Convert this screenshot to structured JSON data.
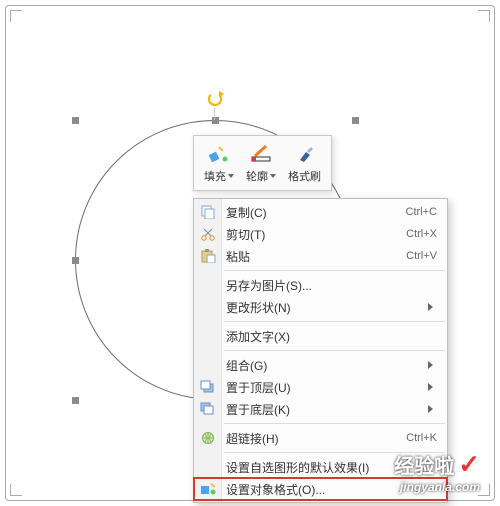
{
  "toolbar": {
    "fill": "填充",
    "outline": "轮廓",
    "format_brush": "格式刷"
  },
  "menu": {
    "copy": {
      "label": "复制(C)",
      "shortcut": "Ctrl+C"
    },
    "cut": {
      "label": "剪切(T)",
      "shortcut": "Ctrl+X"
    },
    "paste": {
      "label": "粘贴",
      "shortcut": "Ctrl+V"
    },
    "save_as_pic": {
      "label": "另存为图片(S)..."
    },
    "change_shape": {
      "label": "更改形状(N)"
    },
    "add_text": {
      "label": "添加文字(X)"
    },
    "group": {
      "label": "组合(G)"
    },
    "bring_front": {
      "label": "置于顶层(U)"
    },
    "send_back": {
      "label": "置于底层(K)"
    },
    "hyperlink": {
      "label": "超链接(H)",
      "shortcut": "Ctrl+K"
    },
    "default_effect": {
      "label": "设置自选图形的默认效果(I)"
    },
    "object_format": {
      "label": "设置对象格式(O)..."
    }
  },
  "watermark": {
    "title": "经验啦",
    "url": "jingyanla.com"
  }
}
